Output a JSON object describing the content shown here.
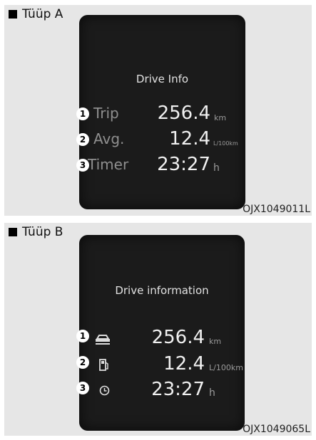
{
  "type_a": {
    "label": "Tüüp A",
    "code": "OJX1049011L",
    "title": "Drive Info",
    "rows": [
      {
        "num": "1",
        "label": "Trip",
        "value": "256.4",
        "unit": "km"
      },
      {
        "num": "2",
        "label": "Avg.",
        "value": "12.4",
        "unit": "L/100km"
      },
      {
        "num": "3",
        "label": "Timer",
        "value": "23:27",
        "unit": "h"
      }
    ]
  },
  "type_b": {
    "label": "Tüüp B",
    "code": "OJX1049065L",
    "title": "Drive information",
    "rows": [
      {
        "num": "1",
        "icon": "car-trip-icon",
        "value": "256.4",
        "unit": "km"
      },
      {
        "num": "2",
        "icon": "fuel-pump-icon",
        "value": "12.4",
        "unit": "L/100km"
      },
      {
        "num": "3",
        "icon": "clock-icon",
        "value": "23:27",
        "unit": "h"
      }
    ]
  }
}
